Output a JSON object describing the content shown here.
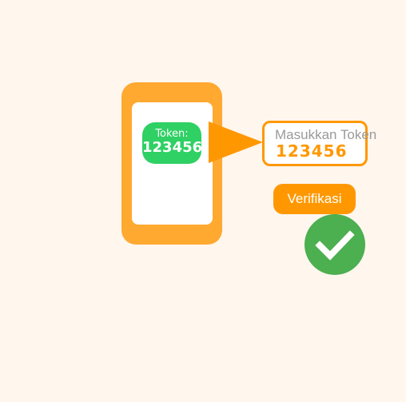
{
  "phone": {
    "token_label": "Token:",
    "token_code": "123456"
  },
  "input": {
    "placeholder": "Masukkan Token",
    "value": "123456"
  },
  "verify_button": {
    "label": "Verifikasi"
  },
  "icons": {
    "arrow": "arrow-right-icon",
    "check": "check-circle-icon"
  },
  "colors": {
    "background": "#fff6ee",
    "phone_body": "#ffa930",
    "token_badge": "#2fd064",
    "accent": "#ff9800",
    "success": "#4caf50"
  }
}
